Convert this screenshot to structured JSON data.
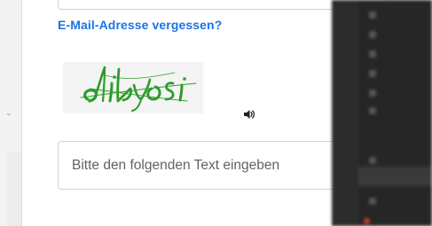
{
  "login": {
    "forgot_email_link": "E-Mail-Adresse vergessen?",
    "captcha_text": "dibyosi",
    "captcha_input_placeholder": "Bitte den folgenden Text eingeben",
    "captcha_input_value": ""
  },
  "icons": {
    "audio": "speaker-icon"
  },
  "colors": {
    "link": "#1a73e8",
    "captcha_text": "#2e9c2a",
    "input_border": "#d3d3d3",
    "background_panel": "#262626"
  }
}
